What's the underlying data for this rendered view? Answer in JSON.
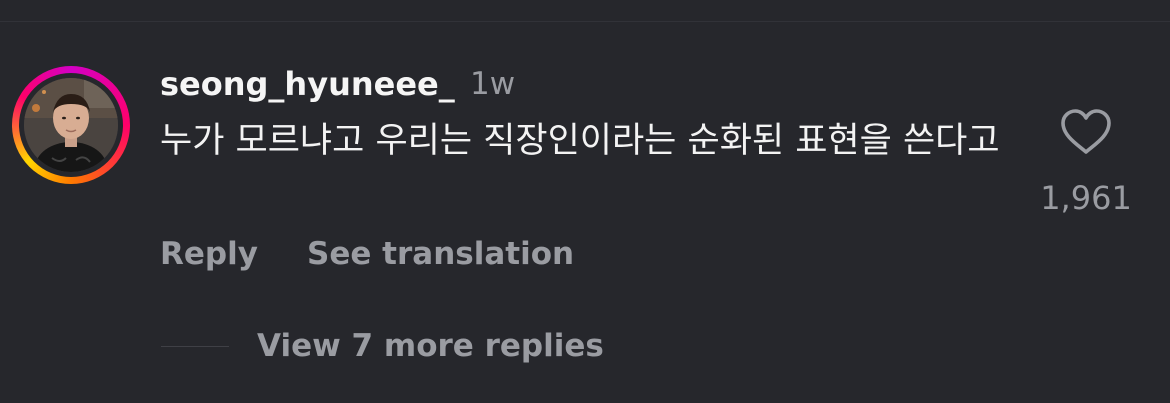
{
  "comment": {
    "username": "seong_hyuneee_",
    "timestamp": "1w",
    "text": "누가 모르냐고 우리는 직장인이라는 순화된 표현을 쓴다고",
    "like_count": "1,961",
    "actions": {
      "reply_label": "Reply",
      "translate_label": "See translation"
    },
    "replies": {
      "view_more_label": "View 7 more replies"
    },
    "avatar": {
      "has_story_ring": true,
      "ring_colors": [
        "#d300c5",
        "#ff0069",
        "#ff7a00",
        "#ffd600"
      ]
    },
    "like_icon": "heart-outline-icon"
  },
  "colors": {
    "background": "#26272c",
    "primary_text": "#f3f3f3",
    "secondary_text": "#9a9ca2"
  }
}
